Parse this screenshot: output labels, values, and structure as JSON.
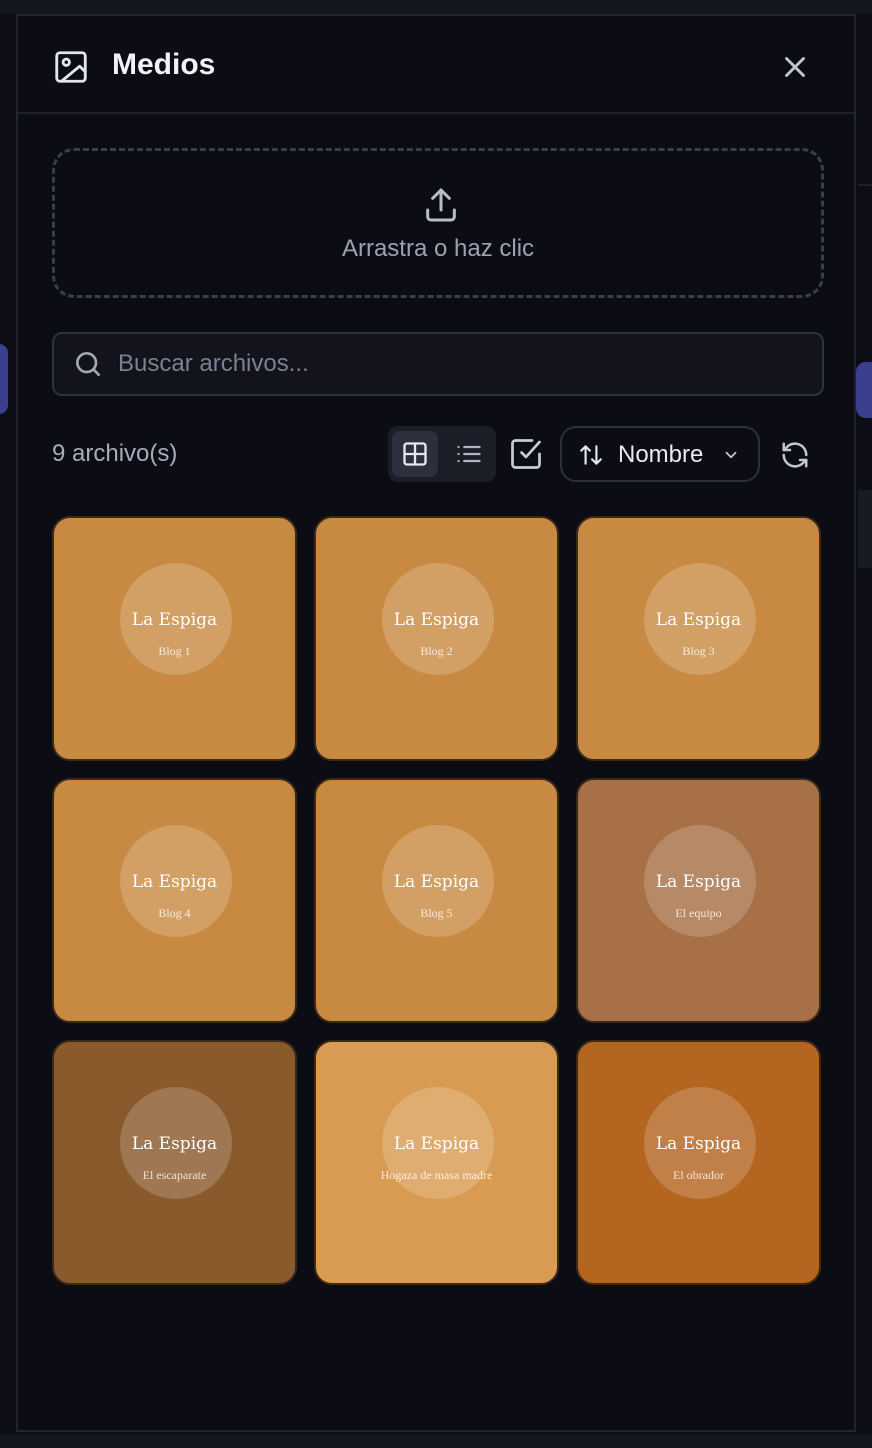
{
  "panel": {
    "title": "Medios",
    "dropzone_label": "Arrastra o haz clic",
    "search_placeholder": "Buscar archivos...",
    "file_count": "9 archivo(s)",
    "sort_label": "Nombre",
    "colors": {
      "background": "#0c0d14",
      "accent": "#3a3f8f"
    }
  },
  "media": [
    {
      "brand": "La Espiga",
      "caption": "Blog 1",
      "color": "#c88a42"
    },
    {
      "brand": "La Espiga",
      "caption": "Blog 2",
      "color": "#c88a42"
    },
    {
      "brand": "La Espiga",
      "caption": "Blog 3",
      "color": "#c88a42"
    },
    {
      "brand": "La Espiga",
      "caption": "Blog 4",
      "color": "#c88a42"
    },
    {
      "brand": "La Espiga",
      "caption": "Blog 5",
      "color": "#c88a42"
    },
    {
      "brand": "La Espiga",
      "caption": "El equipo",
      "color": "#a77046"
    },
    {
      "brand": "La Espiga",
      "caption": "El escaparate",
      "color": "#8a5a2d"
    },
    {
      "brand": "La Espiga",
      "caption": "Hogaza de masa madre",
      "color": "#d89b51"
    },
    {
      "brand": "La Espiga",
      "caption": "El obrador",
      "color": "#b4651f"
    }
  ]
}
